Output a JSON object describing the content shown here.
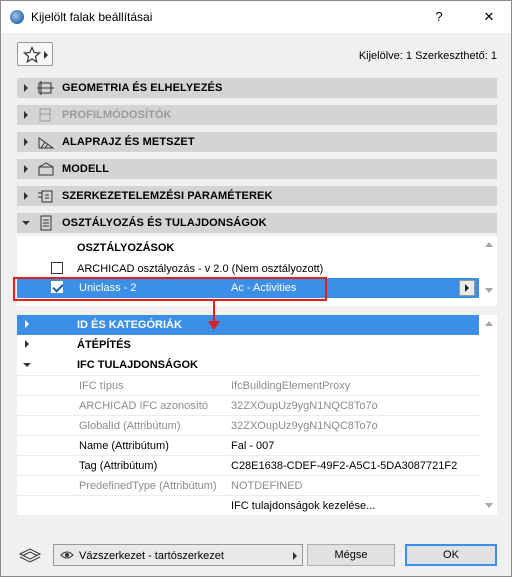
{
  "window": {
    "title": "Kijelölt falak beállításai",
    "help": "?",
    "close": "✕"
  },
  "selection_info": "Kijelölve: 1 Szerkeszthető: 1",
  "sections": [
    {
      "label": "GEOMETRIA ÉS ELHELYEZÉS",
      "icon": "geometry-icon",
      "disabled": false
    },
    {
      "label": "PROFILMÓDOSÍTÓK",
      "icon": "profile-modifier-icon",
      "disabled": true
    },
    {
      "label": "ALAPRAJZ ÉS METSZET",
      "icon": "floorplan-section-icon",
      "disabled": false
    },
    {
      "label": "MODELL",
      "icon": "model-icon",
      "disabled": false
    },
    {
      "label": "SZERKEZETELEMZÉSI PARAMÉTEREK",
      "icon": "structural-analysis-icon",
      "disabled": false
    },
    {
      "label": "OSZTÁLYOZÁS ÉS TULAJDONSÁGOK",
      "icon": "classification-icon",
      "disabled": false
    }
  ],
  "classification": {
    "header": "OSZTÁLYOZÁSOK",
    "rows": [
      {
        "system": "ARCHICAD osztályozás - v 2.0 (Nem osztályozott)",
        "value": "",
        "checked": false
      },
      {
        "system": "Uniclass - 2",
        "value": "Ac - Activities",
        "checked": true
      }
    ]
  },
  "properties": {
    "groups": [
      {
        "label": "ID ÉS KATEGÓRIÁK",
        "expanded": false,
        "selected": true
      },
      {
        "label": "ÁTÉPÍTÉS",
        "expanded": false,
        "selected": false
      },
      {
        "label": "IFC TULAJDONSÁGOK",
        "expanded": true,
        "selected": false
      }
    ],
    "ifc_rows": [
      {
        "key": "IFC típus",
        "value": "IfcBuildingElementProxy",
        "dim": true
      },
      {
        "key": "ARCHICAD IFC azonosító",
        "value": "32ZXOupUz9ygN1NQC8To7o",
        "dim": true
      },
      {
        "key": "GlobalId (Attribútum)",
        "value": "32ZXOupUz9ygN1NQC8To7o",
        "dim": true
      },
      {
        "key": "Name (Attribútum)",
        "value": "Fal - 007",
        "dim": false
      },
      {
        "key": "Tag (Attribútum)",
        "value": "C28E1638-CDEF-49F2-A5C1-5DA3087721F2",
        "dim": false
      },
      {
        "key": "PredefinedType (Attribútum)",
        "value": "NOTDEFINED",
        "dim": true
      },
      {
        "key": "",
        "value": "IFC tulajdonságok kezelése...",
        "dim": false
      }
    ]
  },
  "footer": {
    "layer_dropdown": "Vázszerkezet - tartószerkezet",
    "cancel": "Mégse",
    "ok": "OK"
  },
  "colors": {
    "selection": "#3c8fe6",
    "highlight": "#e02020",
    "section_bg": "#d4d4d4"
  }
}
